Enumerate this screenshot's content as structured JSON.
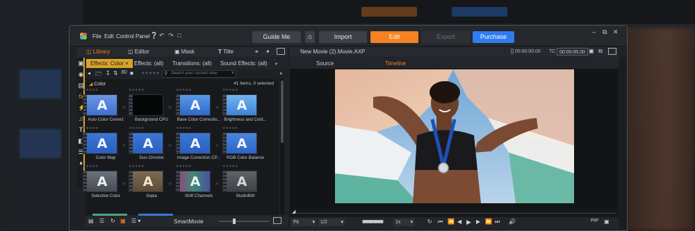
{
  "menu": {
    "file": "File",
    "edit": "Edit",
    "control_panel": "Control Panel"
  },
  "top_buttons": {
    "guide": "Guide Me",
    "import": "Import",
    "edit": "Edit",
    "export": "Export",
    "purchase": "Purchase"
  },
  "colors": {
    "accent_orange": "#f58220",
    "purchase_blue": "#2f7cf0",
    "tab_yellow": "#d9a32a"
  },
  "left_tabs": {
    "library": "Library",
    "editor": "Editor",
    "mask": "Mask",
    "title": "Title"
  },
  "effect_tabs": {
    "color": "Effects: Color",
    "effects_all": "Effects: (all)",
    "transitions_all": "Transitions: (all)",
    "sound_all": "Sound Effects: (all)"
  },
  "toolbar": {
    "mode_3d": "3D",
    "search_placeholder": "Search your current view"
  },
  "category": {
    "name": "Color",
    "count": "41 items, 0 selected"
  },
  "items": [
    {
      "label": "Auto Color Correct",
      "icon": "A"
    },
    {
      "label": "Background CPU",
      "icon": ""
    },
    {
      "label": "Base Color Correctio...",
      "icon": "A"
    },
    {
      "label": "Brightness and Cont...",
      "icon": "A"
    },
    {
      "label": "Color Map",
      "icon": "A"
    },
    {
      "label": "Duo Chrome",
      "icon": "A"
    },
    {
      "label": "Image Correction CP...",
      "icon": "A"
    },
    {
      "label": "RGB Color Balance",
      "icon": "A"
    },
    {
      "label": "Selective Color",
      "icon": "A"
    },
    {
      "label": "Sepia",
      "icon": "A"
    },
    {
      "label": "Shift Channels",
      "icon": "A"
    },
    {
      "label": "StudioBW",
      "icon": "A"
    }
  ],
  "bottom_left": {
    "smartmovie": "SmartMovie"
  },
  "project": {
    "name": "New Movie (2).Movie.AXP",
    "in_tc": "[] 00:00:00.00",
    "tc_label": "TC",
    "tc_value": "00:00:00.00"
  },
  "viewer_tabs": {
    "source": "Source",
    "timeline": "Timeline"
  },
  "controls": {
    "fit": "Fit",
    "half": "1/2",
    "speed": "1x",
    "pip": "PIP"
  }
}
